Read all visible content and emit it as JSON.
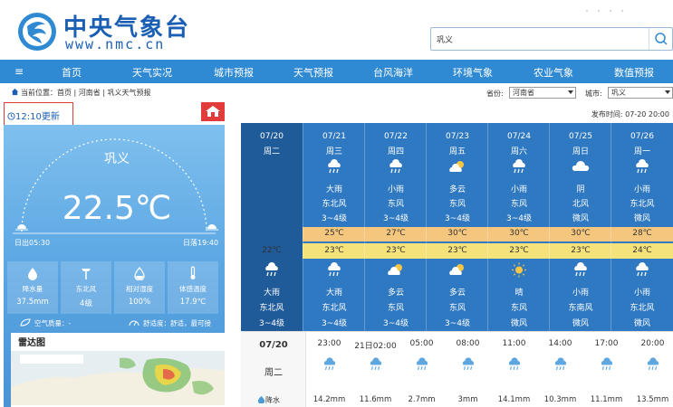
{
  "site": {
    "title": "中央气象台",
    "url": "www.nmc.cn"
  },
  "search": {
    "value": "巩义"
  },
  "nav": {
    "items": [
      "首页",
      "天气实况",
      "城市预报",
      "天气预报",
      "台风海洋",
      "环境气象",
      "农业气象",
      "数值预报"
    ]
  },
  "breadcrumb": {
    "text": "当前位置：首页 | 河南省 | 巩义天气预报"
  },
  "selectors": {
    "province_label": "省份:",
    "province_value": "河南省",
    "city_label": "城市:",
    "city_value": "巩义"
  },
  "update": {
    "text": "12:10更新"
  },
  "publish": {
    "text": "发布时间: 07-20 20:00"
  },
  "current": {
    "city": "巩义",
    "temp": "22.5℃",
    "sunrise": "日出05:30",
    "sunset": "日落19:40",
    "stats": [
      {
        "icon": "raindrop-icon",
        "label": "降水量",
        "value": "37.5mm"
      },
      {
        "icon": "wind-icon",
        "label": "东北风",
        "value": "4级"
      },
      {
        "icon": "humidity-icon",
        "label": "相对湿度",
        "value": "100%"
      },
      {
        "icon": "thermometer-icon",
        "label": "体感温度",
        "value": "17.9℃"
      }
    ],
    "air_quality": "空气质量：-",
    "comfort": "舒适度：舒适，最可接",
    "radar_title": "雷达图"
  },
  "forecast": {
    "days": [
      {
        "date": "07/20",
        "weekday": "周二",
        "day_weather": "",
        "day_wind": "",
        "day_level": "",
        "high": "",
        "low": "22℃",
        "night_icon": "rain-icon",
        "night_weather": "大雨",
        "night_wind": "东北风",
        "night_level": "3~4级"
      },
      {
        "date": "07/21",
        "weekday": "周三",
        "day_icon": "rain-icon",
        "day_weather": "大雨",
        "day_wind": "东北风",
        "day_level": "3~4级",
        "high": "25℃",
        "low": "23℃",
        "night_icon": "rain-icon",
        "night_weather": "大雨",
        "night_wind": "东北风",
        "night_level": "3~4级"
      },
      {
        "date": "07/22",
        "weekday": "周四",
        "day_icon": "rain-icon",
        "day_weather": "小雨",
        "day_wind": "东风",
        "day_level": "3~4级",
        "high": "27℃",
        "low": "23℃",
        "night_icon": "partly-cloudy-icon",
        "night_weather": "多云",
        "night_wind": "东风",
        "night_level": "3~4级"
      },
      {
        "date": "07/23",
        "weekday": "周五",
        "day_icon": "partly-cloudy-icon",
        "day_weather": "多云",
        "day_wind": "东风",
        "day_level": "3~4级",
        "high": "30℃",
        "low": "23℃",
        "night_icon": "partly-cloudy-icon",
        "night_weather": "多云",
        "night_wind": "东风",
        "night_level": "3~4级"
      },
      {
        "date": "07/24",
        "weekday": "周六",
        "day_icon": "rain-icon",
        "day_weather": "小雨",
        "day_wind": "东风",
        "day_level": "3~4级",
        "high": "30℃",
        "low": "23℃",
        "night_icon": "sun-icon",
        "night_weather": "晴",
        "night_wind": "东风",
        "night_level": "微风"
      },
      {
        "date": "07/25",
        "weekday": "周日",
        "day_icon": "cloudy-icon",
        "day_weather": "阴",
        "day_wind": "北风",
        "day_level": "微风",
        "high": "30℃",
        "low": "23℃",
        "night_icon": "rain-icon",
        "night_weather": "小雨",
        "night_wind": "东南风",
        "night_level": "微风"
      },
      {
        "date": "07/26",
        "weekday": "周一",
        "day_icon": "rain-icon",
        "day_weather": "小雨",
        "day_wind": "东北风",
        "day_level": "微风",
        "high": "28℃",
        "low": "24℃",
        "night_icon": "rain-icon",
        "night_weather": "小雨",
        "night_wind": "东北风",
        "night_level": "微风"
      }
    ]
  },
  "hourly": {
    "date": "07/20",
    "weekday": "周二",
    "precip_label": "降水",
    "hours": [
      {
        "time": "23:00",
        "precip": "14.2mm"
      },
      {
        "time": "21日02:00",
        "precip": "11.6mm"
      },
      {
        "time": "05:00",
        "precip": "2.7mm"
      },
      {
        "time": "08:00",
        "precip": "3mm"
      },
      {
        "time": "11:00",
        "precip": "14.1mm"
      },
      {
        "time": "14:00",
        "precip": "10.3mm"
      },
      {
        "time": "17:00",
        "precip": "11.1mm"
      },
      {
        "time": "20:00",
        "precip": "13.5mm"
      }
    ]
  },
  "colors": {
    "brand": "#1a5fb4",
    "nav": "#2f8ad3",
    "forecast_bg": "#2f79c2",
    "today_bg": "#1f5a99",
    "high_bar": "#f5c77e",
    "low_bar": "#f6e27a",
    "highlight": "#e23b3b"
  }
}
